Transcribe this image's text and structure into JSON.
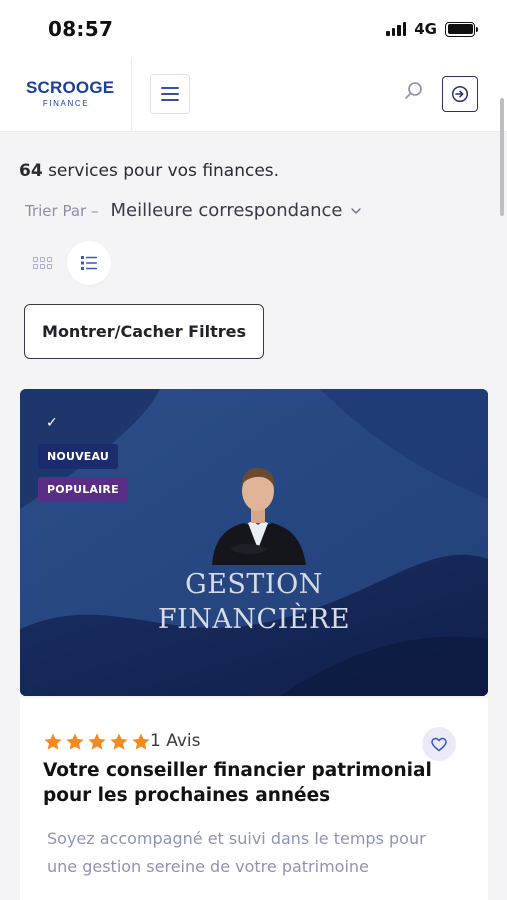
{
  "status_bar": {
    "time": "08:57",
    "network": "4G"
  },
  "header": {
    "logo_line1": "SCROOGE",
    "logo_line2": "FINANCE"
  },
  "results": {
    "count": "64",
    "count_suffix": " services pour vos finances.",
    "sort_label": "Trier Par –",
    "sort_value": "Meilleure correspondance"
  },
  "filter_button": "Montrer/Cacher Filtres",
  "card": {
    "check": "✓",
    "badges": [
      "NOUVEAU",
      "POPULAIRE"
    ],
    "image_title_line1": "GESTION",
    "image_title_line2": "FINANCIÈRE",
    "rating": 5,
    "reviews": "1 Avis",
    "title": "Votre conseiller financier patrimonial pour les prochaines années",
    "description": "Soyez accompagné et suivi dans le temps pour une gestion sereine de votre patrimoine"
  },
  "colors": {
    "brand": "#1b3f9e",
    "card_bg": "#26457e",
    "star": "#f28a1e",
    "badge_new": "#1c2a6e",
    "badge_popular": "#5a2e86"
  },
  "icons": [
    "menu-icon",
    "search-icon",
    "login-icon",
    "grid-view-icon",
    "list-view-icon",
    "chevron-down-icon",
    "heart-icon",
    "star-icon"
  ]
}
